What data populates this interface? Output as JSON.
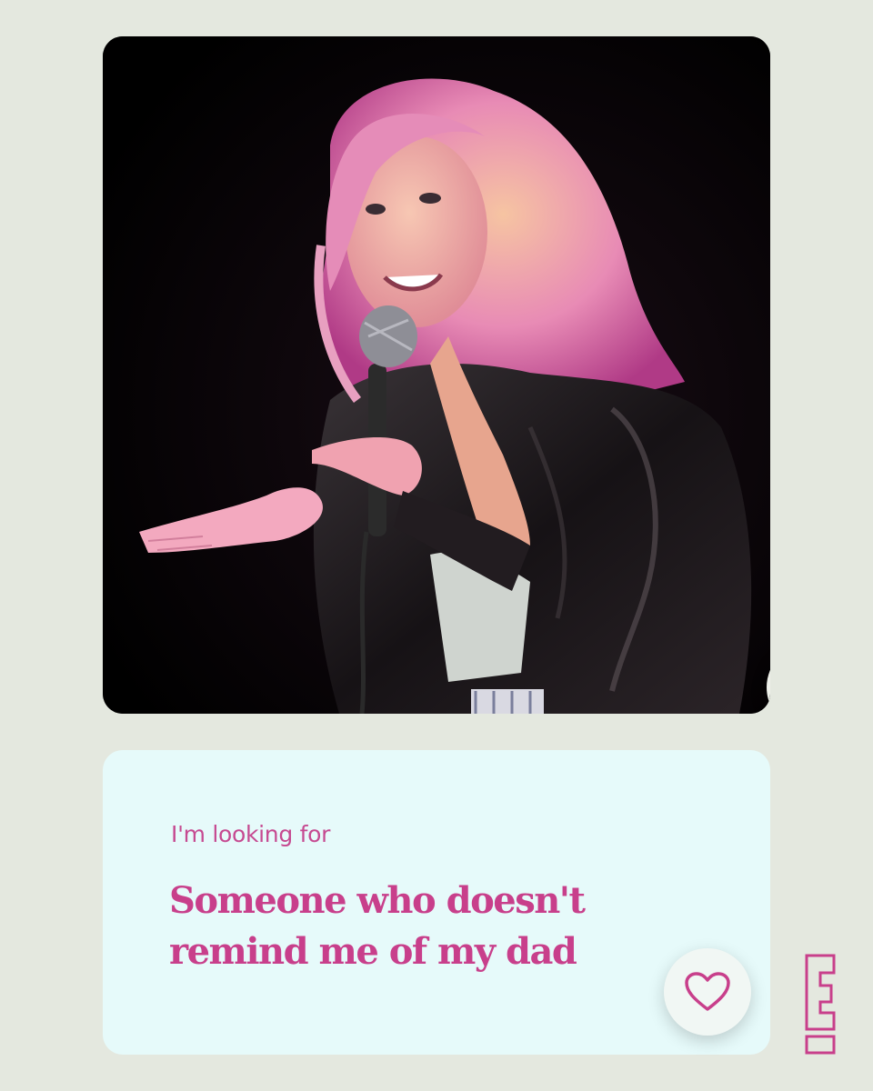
{
  "profile": {
    "photo_icon": "heart-icon",
    "prompt": {
      "label": "I'm looking for",
      "answer": "Someone who doesn't remind me of my dad"
    },
    "like_icon": "heart-icon"
  },
  "brand": {
    "logo": "E!",
    "accent_color": "#c83f8b",
    "background_color": "#e4e8df",
    "prompt_background": "#e6fafa"
  }
}
